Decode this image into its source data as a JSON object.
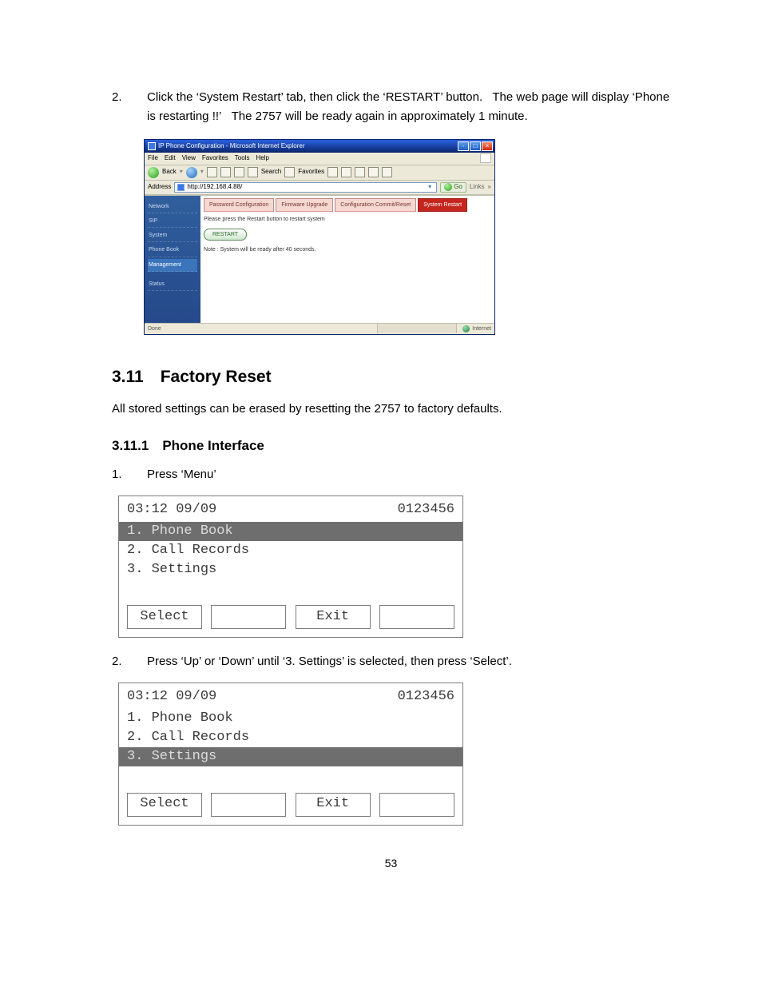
{
  "page_number": "53",
  "intro_step": {
    "num": "2.",
    "text": "Click the ‘System Restart’ tab, then click the ‘RESTART’ button.   The web page will display ‘Phone is restarting !!’   The 2757 will be ready again in approximately 1 minute."
  },
  "ie": {
    "title": "IP Phone Configuration - Microsoft Internet Explorer",
    "menus": [
      "File",
      "Edit",
      "View",
      "Favorites",
      "Tools",
      "Help"
    ],
    "toolbar": {
      "back": "Back",
      "search": "Search",
      "favorites": "Favorites"
    },
    "address_label": "Address",
    "address_value": "http://192.168.4.88/",
    "go": "Go",
    "links": "Links",
    "sidebar": [
      "Network",
      "SIP",
      "System",
      "Phone Book",
      "Management",
      "Status"
    ],
    "sidebar_active": "Management",
    "tabs": [
      "Password Configuration",
      "Firmware Upgrade",
      "Configuration Commit/Reset",
      "System Restart"
    ],
    "active_tab": "System Restart",
    "instruction": "Please press the Restart button to restart system",
    "restart_btn": "RESTART",
    "note": "Note : System will be ready after 40 seconds.",
    "status_done": "Done",
    "status_zone": "Internet"
  },
  "heading_311": "3.11 Factory Reset",
  "para_311": "All stored settings can be erased by resetting the 2757 to factory defaults.",
  "heading_3111": "3.11.1 Phone Interface",
  "step1": {
    "num": "1.",
    "text": "Press ‘Menu’"
  },
  "lcd1": {
    "time": "03:12 09/09",
    "acct": "0123456",
    "rows": [
      "1. Phone Book",
      "2. Call Records",
      "3. Settings"
    ],
    "selected": 0,
    "btn_left": "Select",
    "btn_mid": "Exit"
  },
  "step2": {
    "num": "2.",
    "text": "Press ‘Up’ or ‘Down’ until ‘3. Settings’ is selected, then press ‘Select’."
  },
  "lcd2": {
    "time": "03:12 09/09",
    "acct": "0123456",
    "rows": [
      "1. Phone Book",
      "2. Call Records",
      "3. Settings"
    ],
    "selected": 2,
    "btn_left": "Select",
    "btn_mid": "Exit"
  }
}
